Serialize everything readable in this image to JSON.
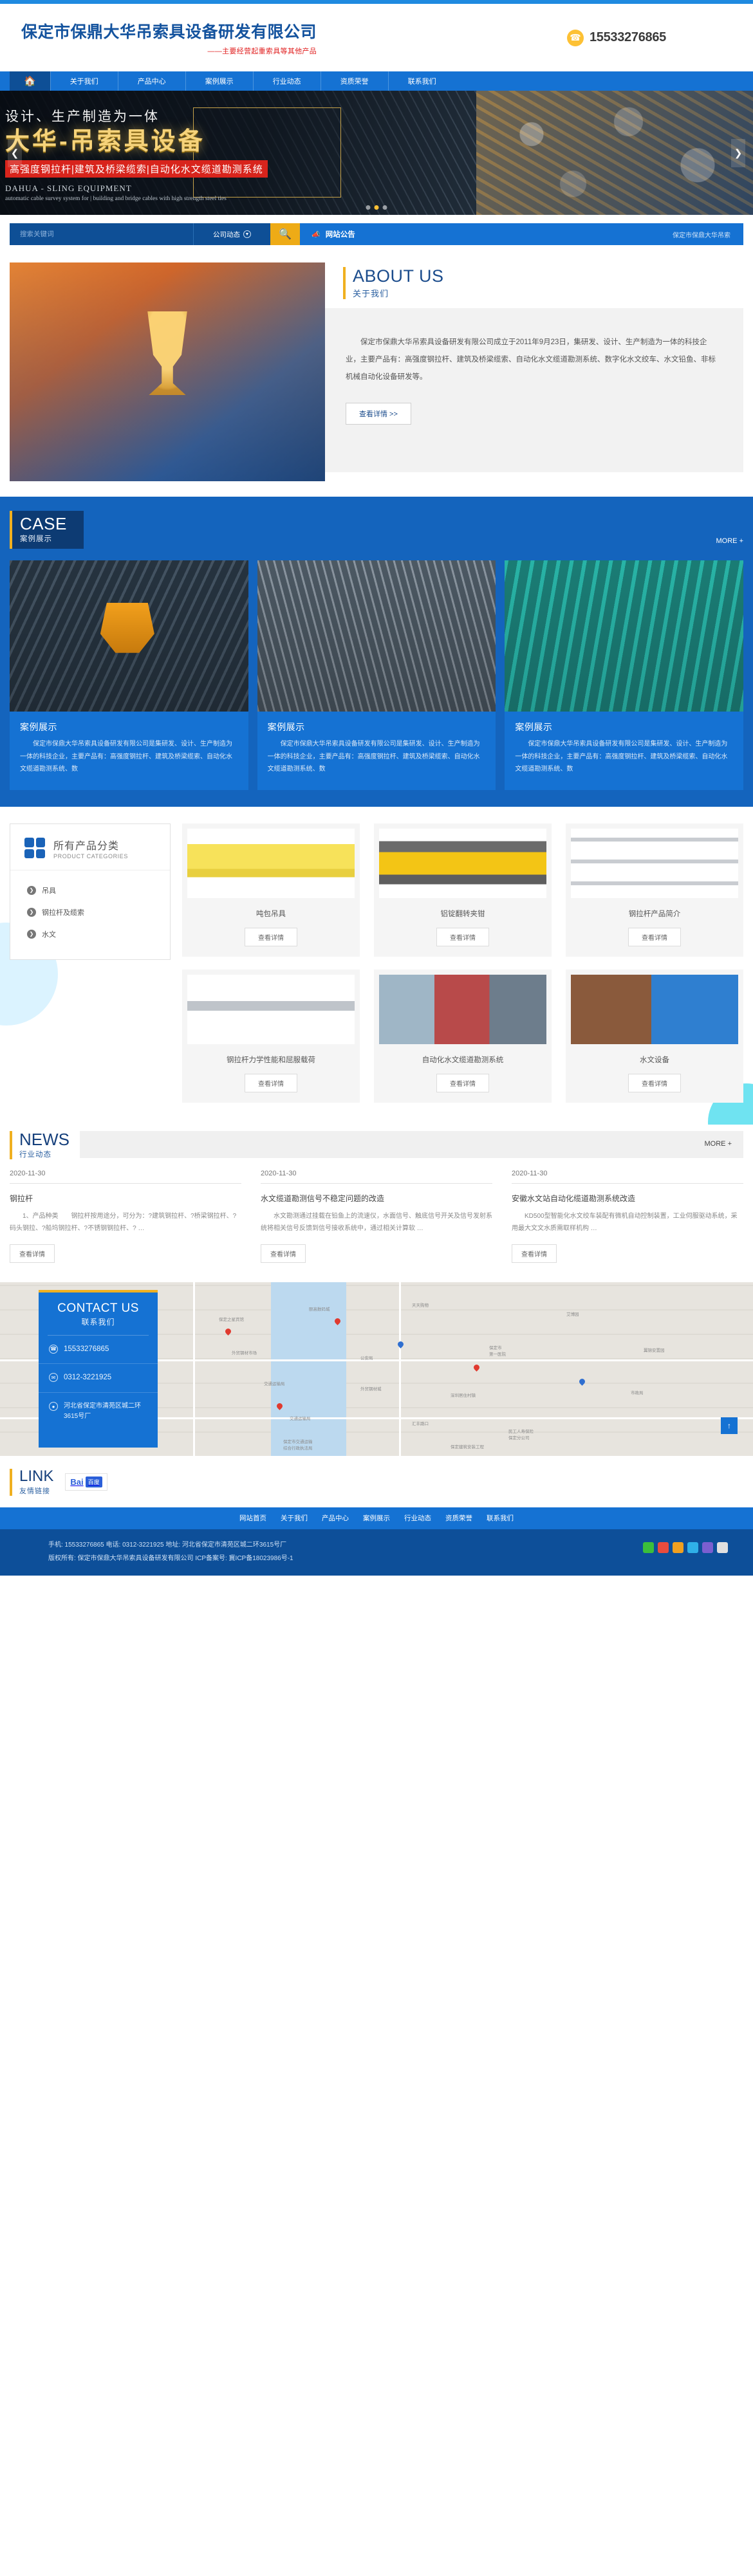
{
  "header": {
    "logo_title": "保定市保鼎大华吊索具设备研发有限公司",
    "logo_sub": "——主要经营起重索具等其他产品",
    "phone_icon": "phone-icon",
    "phone": "15533276865"
  },
  "nav": {
    "home_icon": "home-icon",
    "items": [
      {
        "label": "关于我们"
      },
      {
        "label": "产品中心"
      },
      {
        "label": "案例展示"
      },
      {
        "label": "行业动态"
      },
      {
        "label": "资质荣誉"
      },
      {
        "label": "联系我们"
      }
    ]
  },
  "banner": {
    "line1": "设计、生产制造为一体",
    "line2": "大华-吊索具设备",
    "line3": "高强度钢拉杆|建筑及桥梁缆索|自动化水文缆道勘测系统",
    "line4": "DAHUA - SLING EQUIPMENT",
    "line5": "automatic cable survey system for | building and bridge cables with high strength steel ties",
    "prev_icon": "chevron-left-icon",
    "next_icon": "chevron-right-icon",
    "dots": 3,
    "active_dot": 1
  },
  "search": {
    "placeholder": "搜索关键词",
    "category": "公司动态",
    "category_icon": "chevron-down-icon",
    "search_icon": "search-icon",
    "notice_icon": "megaphone-icon",
    "notice_label": "网站公告",
    "notice_scroll": "保定市保鼎大华吊索"
  },
  "about": {
    "title_en": "ABOUT US",
    "title_cn": "关于我们",
    "paragraph": "保定市保鼎大华吊索具设备研发有限公司成立于2011年9月23日，集研发、设计、生产制造为一体的科技企业，主要产品有：高强度钢拉杆、建筑及桥梁缆索、自动化水文缆道勘测系统、数字化水文绞车、水文铅鱼、非标机械自动化设备研发等。",
    "button": "查看详情 >>",
    "image_alt": "trophy-hands-image"
  },
  "case": {
    "title_en": "CASE",
    "title_cn": "案例展示",
    "more": "MORE +",
    "cards": [
      {
        "image_alt": "crane-grab-image",
        "heading": "案例展示",
        "text": "保定市保鼎大华吊索具设备研发有限公司是集研发、设计、生产制造为一体的科技企业，主要产品有：高强度钢拉杆、建筑及桥梁缆索、自动化水文缆道勘测系统、数"
      },
      {
        "image_alt": "steel-structure-image",
        "heading": "案例展示",
        "text": "保定市保鼎大华吊索具设备研发有限公司是集研发、设计、生产制造为一体的科技企业，主要产品有：高强度钢拉杆、建筑及桥梁缆索、自动化水文缆道勘测系统、数"
      },
      {
        "image_alt": "bridge-cable-image",
        "heading": "案例展示",
        "text": "保定市保鼎大华吊索具设备研发有限公司是集研发、设计、生产制造为一体的科技企业，主要产品有：高强度钢拉杆、建筑及桥梁缆索、自动化水文缆道勘测系统、数"
      }
    ]
  },
  "products": {
    "cat_title_cn": "所有产品分类",
    "cat_title_en": "PRODUCT CATEGORIES",
    "categories": [
      {
        "label": "吊具"
      },
      {
        "label": "钢拉杆及缆索"
      },
      {
        "label": "水文"
      }
    ],
    "detail_button": "查看详情",
    "items": [
      {
        "name": "吨包吊具",
        "image_alt": "yellow-lifting-beam-image"
      },
      {
        "name": "铝锭翻转夹钳",
        "image_alt": "aluminum-ingot-clamp-image"
      },
      {
        "name": "钢拉杆产品简介",
        "image_alt": "steel-tie-rod-image"
      },
      {
        "name": "钢拉杆力学性能和屈服载荷",
        "image_alt": "tie-rod-mechanics-image"
      },
      {
        "name": "自动化水文缆道勘测系统",
        "image_alt": "hydrology-cableway-image"
      },
      {
        "name": "水文设备",
        "image_alt": "hydrology-equipment-image"
      }
    ]
  },
  "news": {
    "title_en": "NEWS",
    "title_cn": "行业动态",
    "more": "MORE +",
    "detail_button": "查看详情",
    "items": [
      {
        "date": "2020-11-30",
        "heading": "钢拉杆",
        "text": "1、产品种类　　钢拉杆按用途分，可分为：?建筑钢拉杆、?桥梁钢拉杆、?码头钢拉、?船坞钢拉杆、?不锈钢钢拉杆、? …"
      },
      {
        "date": "2020-11-30",
        "heading": "水文缆道勘测信号不稳定问题的改造",
        "text": "水文勘测通过挂载在铅鱼上的流速仪，水面信号、触底信号开关及信号发射系统将相关信号反馈到信号接收系统中，通过相关计算软 …"
      },
      {
        "date": "2020-11-30",
        "heading": "安徽水文站自动化缆道勘测系统改造",
        "text": "KD500型智能化水文绞车装配有微机自动控制装置，工业伺服驱动系统，采用最大文文水质需取样机构 …"
      }
    ]
  },
  "contact": {
    "title_en": "CONTACT US",
    "title_cn": "联系我们",
    "rows": [
      {
        "icon": "phone-icon",
        "value": "15533276865"
      },
      {
        "icon": "fax-icon",
        "value": "0312-3221925"
      },
      {
        "icon": "location-icon",
        "value": "河北省保定市清苑区城二环3615号厂"
      }
    ],
    "back_to_top_icon": "arrow-up-icon"
  },
  "link": {
    "title_en": "LINK",
    "title_cn": "友情链接",
    "logo_text": "Bai",
    "logo_badge": "百度"
  },
  "footer": {
    "nav": [
      {
        "label": "网站首页"
      },
      {
        "label": "关于我们"
      },
      {
        "label": "产品中心"
      },
      {
        "label": "案例展示"
      },
      {
        "label": "行业动态"
      },
      {
        "label": "资质荣誉"
      },
      {
        "label": "联系我们"
      }
    ],
    "line1": "手机: 15533276865    电话: 0312-3221925    地址: 河北省保定市清苑区城二环3615号厂",
    "line2": "版权所有: 保定市保鼎大华吊索具设备研发有限公司        ICP备案号: 冀ICP备18023986号-1",
    "social_icons": [
      "wechat-icon",
      "weibo-icon",
      "qq-icon",
      "share-icon",
      "rss-icon",
      "user-icon"
    ]
  },
  "colors": {
    "brand_blue": "#1572d3",
    "dark_blue": "#0d4f99",
    "navy": "#16407c",
    "accent_yellow": "#f0b020",
    "red": "#d8241c"
  }
}
